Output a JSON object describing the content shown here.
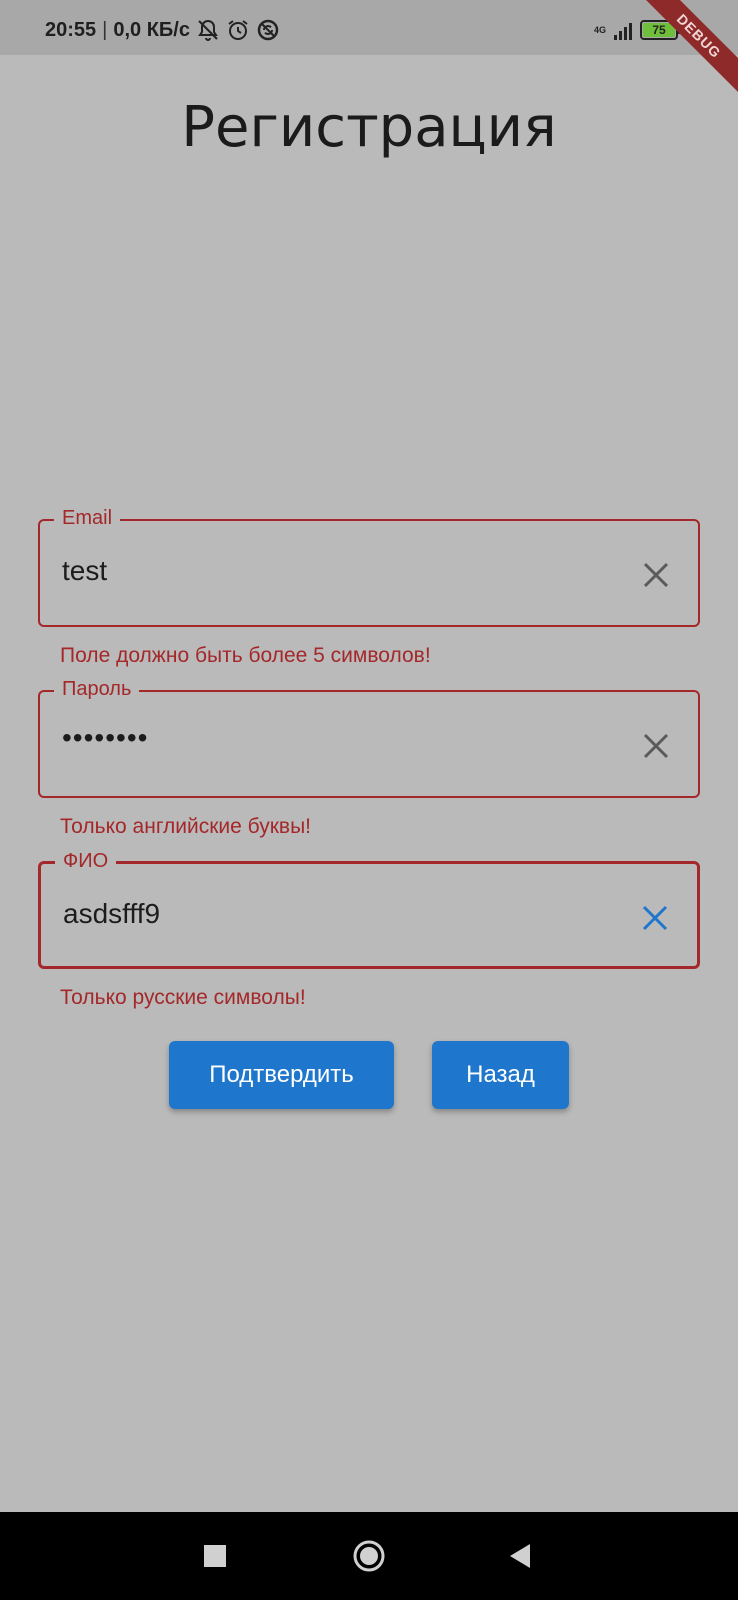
{
  "status_bar": {
    "time": "20:55",
    "separator": "|",
    "speed": "0,0 КБ/с",
    "network": "4G",
    "battery_level": "75",
    "debug_label": "DEBUG",
    "icons": [
      "mute-icon",
      "alarm-icon",
      "sync-icon",
      "signal-icon",
      "battery-icon",
      "charging-icon"
    ]
  },
  "page": {
    "title": "Регистрация"
  },
  "form": {
    "email": {
      "label": "Email",
      "value": "test",
      "error": "Поле должно быть более 5 символов!"
    },
    "password": {
      "label": "Пароль",
      "value": "••••••••",
      "error": "Только английские буквы!"
    },
    "fio": {
      "label": "ФИО",
      "value": "asdsfff9",
      "error": "Только русские символы!"
    }
  },
  "actions": {
    "confirm_label": "Подтвердить",
    "back_label": "Назад"
  },
  "colors": {
    "background": "#bababa",
    "error": "#a4282a",
    "accent": "#1e77cc",
    "icon_gray": "#5a5a5a"
  }
}
